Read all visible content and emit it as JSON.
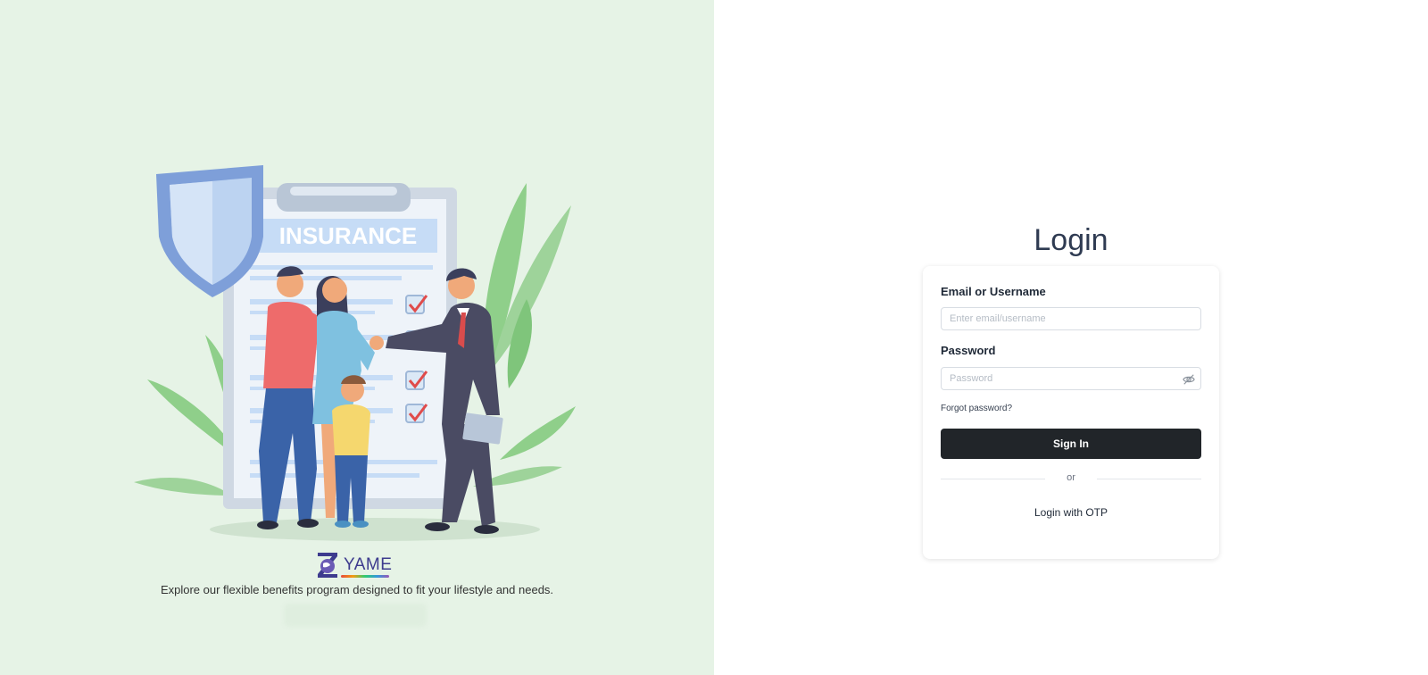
{
  "left_panel": {
    "illustration": {
      "clipboard_heading": "INSURANCE"
    },
    "brand": {
      "name": "YAME"
    },
    "tagline": "Explore our flexible benefits program designed to fit your lifestyle and needs."
  },
  "login": {
    "title": "Login",
    "email_label": "Email or Username",
    "email_placeholder": "Enter email/username",
    "password_label": "Password",
    "password_placeholder": "Password",
    "forgot_password": "Forgot password?",
    "sign_in": "Sign In",
    "divider_text": "or",
    "otp_link": "Login with OTP"
  },
  "colors": {
    "left_bg": "#e6f3e6",
    "primary_button": "#212529",
    "title_color": "#2f3b52"
  },
  "icons": [
    "shield-icon",
    "eye-slash-icon",
    "yame-logo-icon"
  ]
}
